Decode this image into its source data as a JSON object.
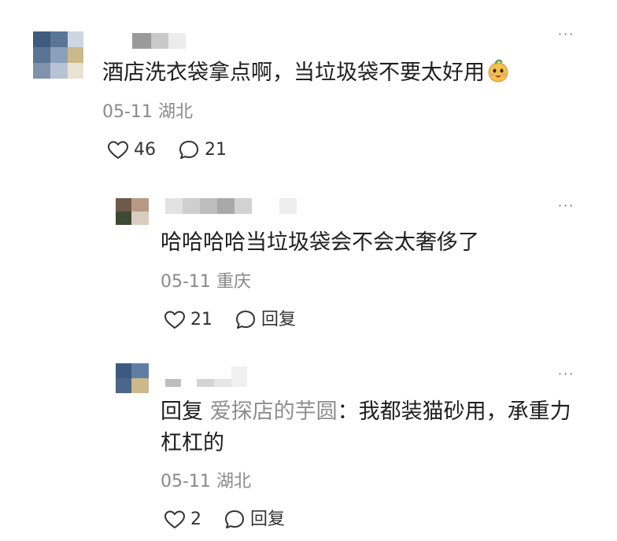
{
  "comments": [
    {
      "text": "酒店洗衣袋拿点啊，当垃圾袋不要太好用",
      "emoji_icon": "smiling-face-emoji",
      "date": "05-11",
      "location": "湖北",
      "likes": "46",
      "replies": "21"
    },
    {
      "text": "哈哈哈哈当垃圾袋会不会太奢侈了",
      "date": "05-11",
      "location": "重庆",
      "likes": "21",
      "reply_label": "回复"
    },
    {
      "reply_prefix": "回复",
      "mention": "爱探店的芋圆",
      "colon": "：",
      "text_line1": "我都装猫砂用，承重力",
      "text_line2": "杠杠的",
      "date": "05-11",
      "location": "湖北",
      "likes": "2",
      "reply_label": "回复"
    }
  ],
  "more_label": "···",
  "colors": {
    "text": "#1e1e1e",
    "meta": "#8a8a8a",
    "mention": "#8d8d8d",
    "icon": "#333333"
  }
}
